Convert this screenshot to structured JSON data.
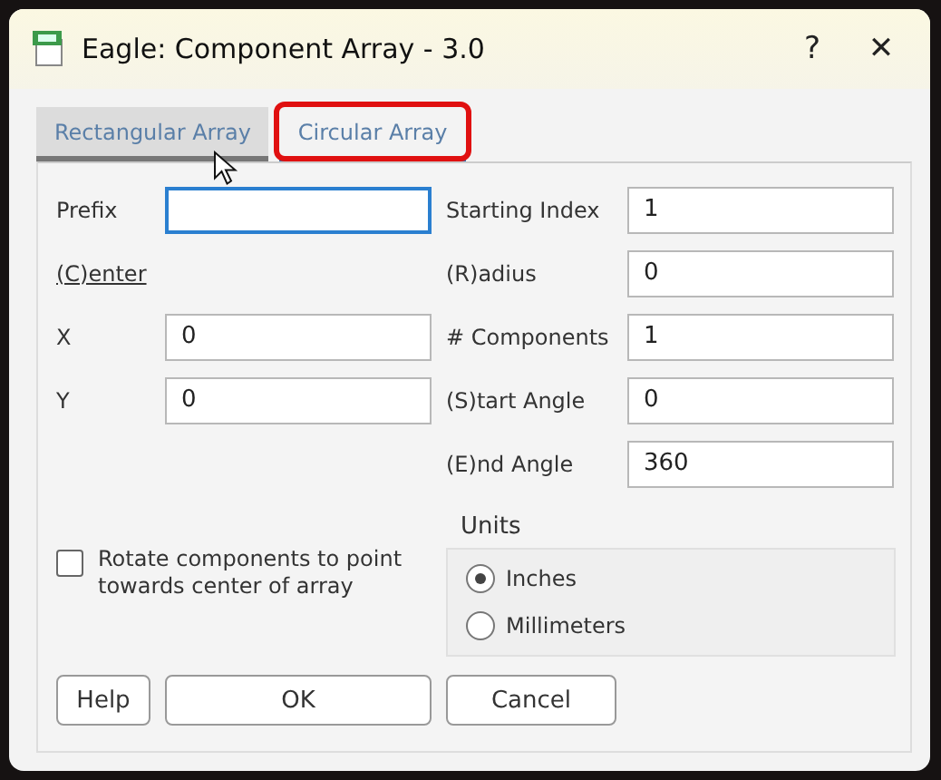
{
  "window": {
    "title": "Eagle: Component Array - 3.0",
    "help_button": "?",
    "close_button": "✕"
  },
  "tabs": [
    {
      "label": "Rectangular Array",
      "selected": false,
      "highlighted": false
    },
    {
      "label": "Circular Array",
      "selected": true,
      "highlighted": true
    }
  ],
  "left_fields": [
    {
      "kind": "field",
      "label": "Prefix",
      "focused": true
    },
    {
      "kind": "heading",
      "label": "(C)enter"
    },
    {
      "kind": "field",
      "label": "X",
      "value": "0",
      "focused": false
    },
    {
      "kind": "field",
      "label": "Y",
      "value": "0",
      "focused": false
    }
  ],
  "right_fields": [
    {
      "label": "Starting Index",
      "value": "1"
    },
    {
      "label": "(R)adius",
      "value": "0"
    },
    {
      "label": "# Components",
      "value": "1"
    },
    {
      "label": "(S)tart Angle",
      "value": "0"
    },
    {
      "label": "(E)nd Angle",
      "value": "360"
    }
  ],
  "rotate_checkbox": {
    "label": "Rotate components to point towards center of array",
    "checked": false
  },
  "units": {
    "title": "Units",
    "options": [
      {
        "label": "Inches",
        "selected": true
      },
      {
        "label": "Millimeters",
        "selected": false
      }
    ]
  },
  "buttons": [
    "Help",
    "OK",
    "Cancel"
  ]
}
